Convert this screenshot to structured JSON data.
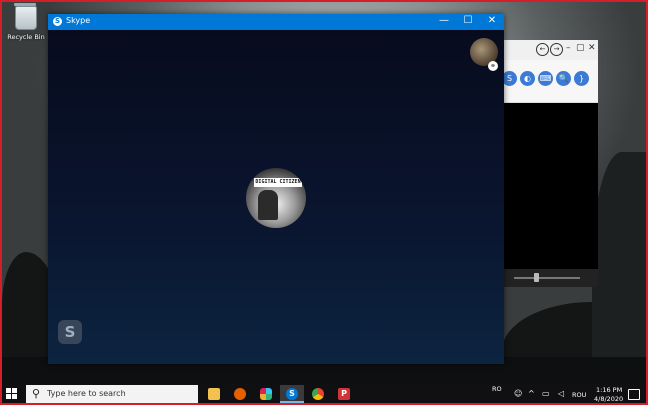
{
  "desktop": {
    "icons": [
      {
        "label": "Recycle Bin",
        "icon": "recycle-bin-icon"
      }
    ]
  },
  "background_window": {
    "nav": {
      "back": "←",
      "forward": "→"
    },
    "window_controls": {
      "minimize": "–",
      "maximize": "▢",
      "close": "✕"
    },
    "toolbar_buttons": [
      "S",
      "◐",
      "⌨",
      "🔍",
      "}"
    ]
  },
  "skype": {
    "title": "Skype",
    "controls": {
      "minimize": "—",
      "maximize": "☐",
      "close": "✕"
    },
    "callee_banner_text": "DIGITAL CITIZEN",
    "logo_letter": "S",
    "badge_icon": "link-icon"
  },
  "taskbar": {
    "search_placeholder": "Type here to search",
    "apps": [
      {
        "name": "file-explorer",
        "color": "#f2c14e",
        "active": false
      },
      {
        "name": "firefox",
        "color": "#e66000",
        "active": false
      },
      {
        "name": "slack",
        "color": "#e8e8e8",
        "active": false
      },
      {
        "name": "skype",
        "color": "#0078d7",
        "active": true
      },
      {
        "name": "chrome",
        "color": "#34a853",
        "active": false
      },
      {
        "name": "presentation-app",
        "color": "#d13438",
        "active": false
      }
    ],
    "tray": {
      "region": "RO",
      "language": "ROU",
      "time": "1:16 PM",
      "date": "4/8/2020"
    }
  },
  "colors": {
    "accent": "#0078d7",
    "frame": "#d41f2b"
  }
}
